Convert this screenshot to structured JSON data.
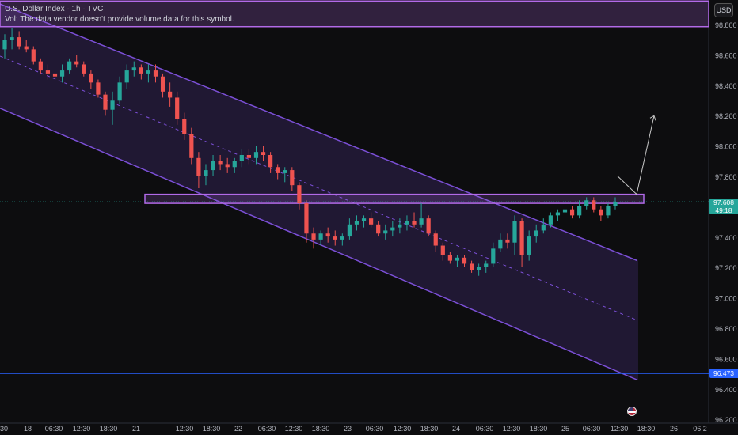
{
  "legend": {
    "symbol": "U.S. Dollar Index · 1h · TVC",
    "volume_note": "Vol: The data vendor doesn't provide volume data for this symbol."
  },
  "currency_button": "USD",
  "last_price": {
    "value": "97.608",
    "countdown": "49:18",
    "color": "#26a69a"
  },
  "support_level": {
    "value": "96.473",
    "color": "#2962ff"
  },
  "colors": {
    "up": "#26a69a",
    "down": "#ef5350",
    "channel": "#7b4fd6",
    "zone": "#b26ae8",
    "projection": "#c8c8c8"
  },
  "chart_data": {
    "type": "candlestick",
    "y_ticks": [
      "98.800",
      "98.600",
      "98.400",
      "98.200",
      "98.000",
      "97.800",
      "97.600",
      "97.400",
      "97.200",
      "97.000",
      "96.800",
      "96.600",
      "96.400",
      "96.200"
    ],
    "x_ticks": [
      "30",
      "18",
      "06:30",
      "12:30",
      "18:30",
      "21",
      "12:30",
      "18:30",
      "22",
      "06:30",
      "12:30",
      "18:30",
      "23",
      "06:30",
      "12:30",
      "18:30",
      "24",
      "06:30",
      "12:30",
      "18:30",
      "25",
      "06:30",
      "12:30",
      "18:30",
      "26",
      "06:2"
    ],
    "ylim": [
      96.2,
      98.85
    ],
    "resistance_zone": [
      97.6,
      97.66
    ],
    "top_zone": [
      98.77,
      98.94
    ],
    "horizontal_line": 96.473,
    "channel_upper": {
      "start": 98.92,
      "end": 97.22
    },
    "channel_lower": {
      "start": 98.23,
      "end": 96.43
    },
    "projection_path": [
      97.78,
      97.66,
      98.18
    ],
    "candles": [
      {
        "o": 98.62,
        "h": 98.72,
        "l": 98.56,
        "c": 98.68
      },
      {
        "o": 98.68,
        "h": 98.76,
        "l": 98.62,
        "c": 98.7
      },
      {
        "o": 98.7,
        "h": 98.74,
        "l": 98.62,
        "c": 98.64
      },
      {
        "o": 98.64,
        "h": 98.68,
        "l": 98.6,
        "c": 98.62
      },
      {
        "o": 98.62,
        "h": 98.64,
        "l": 98.52,
        "c": 98.54
      },
      {
        "o": 98.54,
        "h": 98.56,
        "l": 98.46,
        "c": 98.48
      },
      {
        "o": 98.48,
        "h": 98.52,
        "l": 98.42,
        "c": 98.46
      },
      {
        "o": 98.46,
        "h": 98.5,
        "l": 98.4,
        "c": 98.44
      },
      {
        "o": 98.44,
        "h": 98.52,
        "l": 98.4,
        "c": 98.48
      },
      {
        "o": 98.48,
        "h": 98.56,
        "l": 98.46,
        "c": 98.54
      },
      {
        "o": 98.54,
        "h": 98.58,
        "l": 98.5,
        "c": 98.52
      },
      {
        "o": 98.52,
        "h": 98.54,
        "l": 98.44,
        "c": 98.46
      },
      {
        "o": 98.46,
        "h": 98.48,
        "l": 98.36,
        "c": 98.4
      },
      {
        "o": 98.4,
        "h": 98.42,
        "l": 98.3,
        "c": 98.32
      },
      {
        "o": 98.32,
        "h": 98.34,
        "l": 98.18,
        "c": 98.22
      },
      {
        "o": 98.22,
        "h": 98.34,
        "l": 98.12,
        "c": 98.28
      },
      {
        "o": 98.28,
        "h": 98.44,
        "l": 98.26,
        "c": 98.4
      },
      {
        "o": 98.4,
        "h": 98.52,
        "l": 98.36,
        "c": 98.48
      },
      {
        "o": 98.48,
        "h": 98.54,
        "l": 98.44,
        "c": 98.5
      },
      {
        "o": 98.5,
        "h": 98.52,
        "l": 98.42,
        "c": 98.46
      },
      {
        "o": 98.46,
        "h": 98.52,
        "l": 98.4,
        "c": 98.48
      },
      {
        "o": 98.48,
        "h": 98.52,
        "l": 98.4,
        "c": 98.44
      },
      {
        "o": 98.44,
        "h": 98.46,
        "l": 98.3,
        "c": 98.34
      },
      {
        "o": 98.34,
        "h": 98.4,
        "l": 98.24,
        "c": 98.3
      },
      {
        "o": 98.3,
        "h": 98.34,
        "l": 98.12,
        "c": 98.16
      },
      {
        "o": 98.16,
        "h": 98.2,
        "l": 98.02,
        "c": 98.06
      },
      {
        "o": 98.06,
        "h": 98.1,
        "l": 97.86,
        "c": 97.9
      },
      {
        "o": 97.9,
        "h": 97.94,
        "l": 97.7,
        "c": 97.78
      },
      {
        "o": 97.78,
        "h": 97.86,
        "l": 97.72,
        "c": 97.82
      },
      {
        "o": 97.82,
        "h": 97.92,
        "l": 97.78,
        "c": 97.88
      },
      {
        "o": 97.88,
        "h": 97.92,
        "l": 97.82,
        "c": 97.86
      },
      {
        "o": 97.86,
        "h": 97.9,
        "l": 97.8,
        "c": 97.84
      },
      {
        "o": 97.84,
        "h": 97.9,
        "l": 97.8,
        "c": 97.88
      },
      {
        "o": 97.88,
        "h": 97.96,
        "l": 97.84,
        "c": 97.92
      },
      {
        "o": 97.92,
        "h": 97.96,
        "l": 97.86,
        "c": 97.9
      },
      {
        "o": 97.9,
        "h": 97.98,
        "l": 97.86,
        "c": 97.94
      },
      {
        "o": 97.94,
        "h": 97.98,
        "l": 97.88,
        "c": 97.92
      },
      {
        "o": 97.92,
        "h": 97.94,
        "l": 97.8,
        "c": 97.84
      },
      {
        "o": 97.84,
        "h": 97.86,
        "l": 97.76,
        "c": 97.8
      },
      {
        "o": 97.8,
        "h": 97.84,
        "l": 97.74,
        "c": 97.82
      },
      {
        "o": 97.82,
        "h": 97.84,
        "l": 97.68,
        "c": 97.72
      },
      {
        "o": 97.72,
        "h": 97.74,
        "l": 97.56,
        "c": 97.6
      },
      {
        "o": 97.6,
        "h": 97.62,
        "l": 97.34,
        "c": 97.4
      },
      {
        "o": 97.4,
        "h": 97.44,
        "l": 97.3,
        "c": 97.36
      },
      {
        "o": 97.36,
        "h": 97.42,
        "l": 97.32,
        "c": 97.4
      },
      {
        "o": 97.4,
        "h": 97.44,
        "l": 97.34,
        "c": 97.38
      },
      {
        "o": 97.38,
        "h": 97.42,
        "l": 97.32,
        "c": 97.36
      },
      {
        "o": 97.36,
        "h": 97.4,
        "l": 97.32,
        "c": 97.38
      },
      {
        "o": 97.38,
        "h": 97.5,
        "l": 97.36,
        "c": 97.46
      },
      {
        "o": 97.46,
        "h": 97.52,
        "l": 97.42,
        "c": 97.48
      },
      {
        "o": 97.48,
        "h": 97.52,
        "l": 97.44,
        "c": 97.5
      },
      {
        "o": 97.5,
        "h": 97.54,
        "l": 97.44,
        "c": 97.46
      },
      {
        "o": 97.46,
        "h": 97.48,
        "l": 97.38,
        "c": 97.4
      },
      {
        "o": 97.4,
        "h": 97.46,
        "l": 97.36,
        "c": 97.42
      },
      {
        "o": 97.42,
        "h": 97.48,
        "l": 97.38,
        "c": 97.44
      },
      {
        "o": 97.44,
        "h": 97.5,
        "l": 97.4,
        "c": 97.46
      },
      {
        "o": 97.46,
        "h": 97.52,
        "l": 97.42,
        "c": 97.48
      },
      {
        "o": 97.48,
        "h": 97.54,
        "l": 97.44,
        "c": 97.46
      },
      {
        "o": 97.46,
        "h": 97.6,
        "l": 97.44,
        "c": 97.5
      },
      {
        "o": 97.5,
        "h": 97.52,
        "l": 97.38,
        "c": 97.4
      },
      {
        "o": 97.4,
        "h": 97.42,
        "l": 97.28,
        "c": 97.32
      },
      {
        "o": 97.32,
        "h": 97.34,
        "l": 97.22,
        "c": 97.26
      },
      {
        "o": 97.26,
        "h": 97.28,
        "l": 97.2,
        "c": 97.22
      },
      {
        "o": 97.22,
        "h": 97.26,
        "l": 97.18,
        "c": 97.24
      },
      {
        "o": 97.24,
        "h": 97.26,
        "l": 97.18,
        "c": 97.2
      },
      {
        "o": 97.2,
        "h": 97.22,
        "l": 97.14,
        "c": 97.16
      },
      {
        "o": 97.16,
        "h": 97.2,
        "l": 97.12,
        "c": 97.18
      },
      {
        "o": 97.18,
        "h": 97.22,
        "l": 97.14,
        "c": 97.2
      },
      {
        "o": 97.2,
        "h": 97.34,
        "l": 97.18,
        "c": 97.3
      },
      {
        "o": 97.3,
        "h": 97.4,
        "l": 97.28,
        "c": 97.36
      },
      {
        "o": 97.36,
        "h": 97.4,
        "l": 97.3,
        "c": 97.34
      },
      {
        "o": 97.34,
        "h": 97.52,
        "l": 97.26,
        "c": 97.48
      },
      {
        "o": 97.48,
        "h": 97.5,
        "l": 97.18,
        "c": 97.26
      },
      {
        "o": 97.26,
        "h": 97.42,
        "l": 97.22,
        "c": 97.38
      },
      {
        "o": 97.38,
        "h": 97.46,
        "l": 97.34,
        "c": 97.42
      },
      {
        "o": 97.42,
        "h": 97.5,
        "l": 97.4,
        "c": 97.46
      },
      {
        "o": 97.46,
        "h": 97.54,
        "l": 97.44,
        "c": 97.52
      },
      {
        "o": 97.52,
        "h": 97.56,
        "l": 97.48,
        "c": 97.54
      },
      {
        "o": 97.54,
        "h": 97.6,
        "l": 97.5,
        "c": 97.56
      },
      {
        "o": 97.56,
        "h": 97.58,
        "l": 97.5,
        "c": 97.52
      },
      {
        "o": 97.52,
        "h": 97.62,
        "l": 97.5,
        "c": 97.58
      },
      {
        "o": 97.58,
        "h": 97.64,
        "l": 97.56,
        "c": 97.62
      },
      {
        "o": 97.62,
        "h": 97.64,
        "l": 97.54,
        "c": 97.56
      },
      {
        "o": 97.56,
        "h": 97.58,
        "l": 97.48,
        "c": 97.52
      },
      {
        "o": 97.52,
        "h": 97.6,
        "l": 97.5,
        "c": 97.58
      },
      {
        "o": 97.58,
        "h": 97.64,
        "l": 97.56,
        "c": 97.61
      }
    ]
  }
}
